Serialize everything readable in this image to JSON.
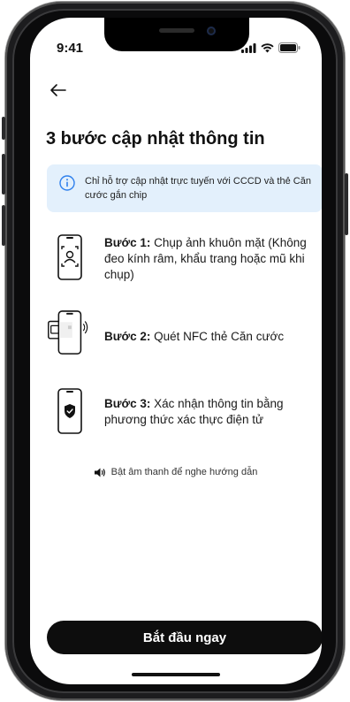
{
  "status_bar": {
    "time": "9:41"
  },
  "header": {
    "title": "3 bước cập nhật thông tin"
  },
  "info_banner": {
    "text": "Chỉ hỗ trợ cập nhật trực tuyến với CCCD và thẻ Căn cước gắn chip"
  },
  "steps": [
    {
      "label": "Bước 1:",
      "text": " Chụp ảnh khuôn mặt (Không đeo kính râm, khẩu trang hoặc mũ khi chụp)"
    },
    {
      "label": "Bước 2:",
      "text": " Quét NFC thẻ Căn cước"
    },
    {
      "label": "Bước 3:",
      "text": " Xác nhận thông tin bằng phương thức xác thực điện tử"
    }
  ],
  "audio_hint": "Bật âm thanh để nghe hướng dẫn",
  "cta_label": "Bắt đầu ngay",
  "colors": {
    "info_bg": "#e3f0fc",
    "info_icon": "#2f80ed",
    "cta_bg": "#0d0d0d"
  },
  "icons": {
    "back": "arrow-left-icon",
    "info": "info-circle-icon",
    "speaker": "speaker-icon"
  }
}
